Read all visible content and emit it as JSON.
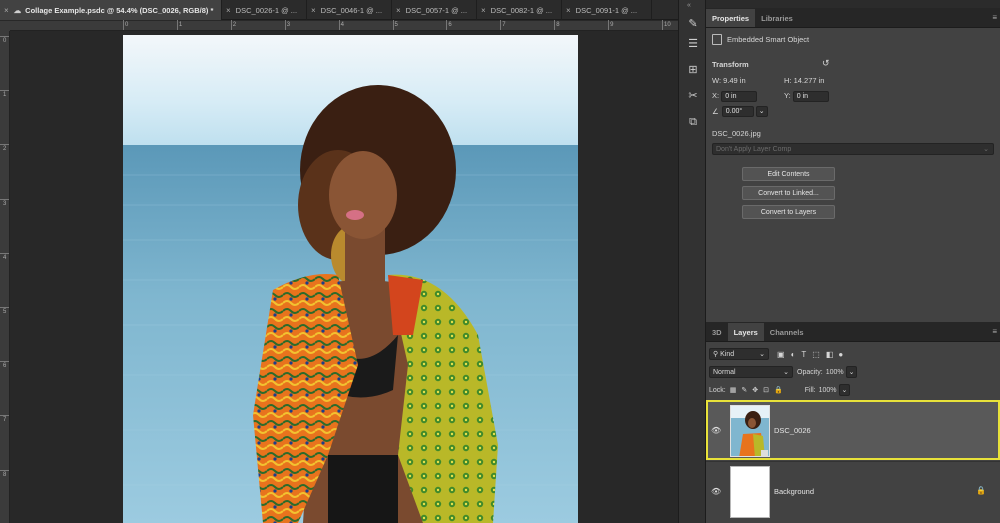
{
  "document_tabs": [
    {
      "label": "Collage Example.psdc @ 54.4% (DSC_0026, RGB/8) *",
      "active": true
    },
    {
      "label": "DSC_0026-1 @ ...",
      "active": false
    },
    {
      "label": "DSC_0046-1 @ ...",
      "active": false
    },
    {
      "label": "DSC_0057-1 @ ...",
      "active": false
    },
    {
      "label": "DSC_0082-1 @ ...",
      "active": false
    },
    {
      "label": "DSC_0091-1 @ ...",
      "active": false
    }
  ],
  "rulers": {
    "top": [
      "0",
      "1",
      "2",
      "3",
      "4",
      "5",
      "6",
      "7",
      "8",
      "9",
      "10"
    ],
    "left": [
      "0",
      "1",
      "2",
      "3",
      "4",
      "5",
      "6",
      "7",
      "8"
    ]
  },
  "properties": {
    "tabs": [
      "Properties",
      "Libraries"
    ],
    "object_type": "Embedded Smart Object",
    "transform_label": "Transform",
    "w_label": "W:",
    "w_value": "9.49 in",
    "h_label": "H:",
    "h_value": "14.277 in",
    "x_label": "X:",
    "x_value": "0 in",
    "y_label": "Y:",
    "y_value": "0 in",
    "angle_value": "0.00°",
    "source_file": "DSC_0026.jpg",
    "layer_comp_placeholder": "Don't Apply Layer Comp",
    "buttons": {
      "edit_contents": "Edit Contents",
      "convert_linked": "Convert to Linked...",
      "convert_layers": "Convert to Layers"
    }
  },
  "layers_panel": {
    "tabs": [
      "3D",
      "Layers",
      "Channels"
    ],
    "filter_label": "Kind",
    "blend_mode": "Normal",
    "opacity_label": "Opacity:",
    "opacity_value": "100%",
    "lock_label": "Lock:",
    "fill_label": "Fill:",
    "fill_value": "100%",
    "layers": [
      {
        "name": "DSC_0026",
        "selected": true
      },
      {
        "name": "Background",
        "selected": false
      }
    ]
  },
  "colors": {
    "selection_outline": "#e8e23a",
    "panel_bg": "#424242",
    "canvas_bg": "#282828"
  }
}
